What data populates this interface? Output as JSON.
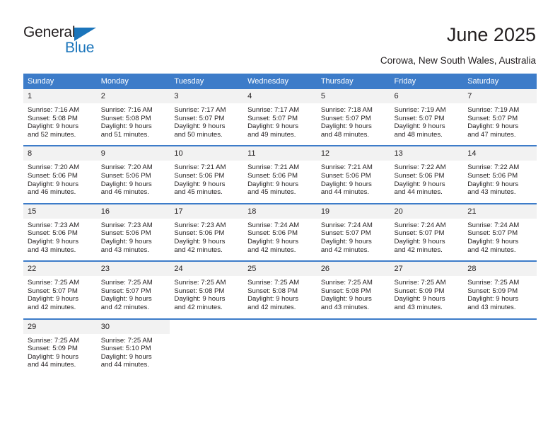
{
  "brand": {
    "name_part1": "General",
    "name_part2": "Blue",
    "accent_color": "#1b75bb"
  },
  "header": {
    "title": "June 2025",
    "subtitle": "Corowa, New South Wales, Australia"
  },
  "calendar": {
    "header_bg": "#3d7cc9",
    "daynum_bg": "#f2f2f2",
    "weekdays": [
      "Sunday",
      "Monday",
      "Tuesday",
      "Wednesday",
      "Thursday",
      "Friday",
      "Saturday"
    ],
    "weeks": [
      [
        {
          "day": "1",
          "sunrise": "Sunrise: 7:16 AM",
          "sunset": "Sunset: 5:08 PM",
          "daylight1": "Daylight: 9 hours",
          "daylight2": "and 52 minutes."
        },
        {
          "day": "2",
          "sunrise": "Sunrise: 7:16 AM",
          "sunset": "Sunset: 5:08 PM",
          "daylight1": "Daylight: 9 hours",
          "daylight2": "and 51 minutes."
        },
        {
          "day": "3",
          "sunrise": "Sunrise: 7:17 AM",
          "sunset": "Sunset: 5:07 PM",
          "daylight1": "Daylight: 9 hours",
          "daylight2": "and 50 minutes."
        },
        {
          "day": "4",
          "sunrise": "Sunrise: 7:17 AM",
          "sunset": "Sunset: 5:07 PM",
          "daylight1": "Daylight: 9 hours",
          "daylight2": "and 49 minutes."
        },
        {
          "day": "5",
          "sunrise": "Sunrise: 7:18 AM",
          "sunset": "Sunset: 5:07 PM",
          "daylight1": "Daylight: 9 hours",
          "daylight2": "and 48 minutes."
        },
        {
          "day": "6",
          "sunrise": "Sunrise: 7:19 AM",
          "sunset": "Sunset: 5:07 PM",
          "daylight1": "Daylight: 9 hours",
          "daylight2": "and 48 minutes."
        },
        {
          "day": "7",
          "sunrise": "Sunrise: 7:19 AM",
          "sunset": "Sunset: 5:07 PM",
          "daylight1": "Daylight: 9 hours",
          "daylight2": "and 47 minutes."
        }
      ],
      [
        {
          "day": "8",
          "sunrise": "Sunrise: 7:20 AM",
          "sunset": "Sunset: 5:06 PM",
          "daylight1": "Daylight: 9 hours",
          "daylight2": "and 46 minutes."
        },
        {
          "day": "9",
          "sunrise": "Sunrise: 7:20 AM",
          "sunset": "Sunset: 5:06 PM",
          "daylight1": "Daylight: 9 hours",
          "daylight2": "and 46 minutes."
        },
        {
          "day": "10",
          "sunrise": "Sunrise: 7:21 AM",
          "sunset": "Sunset: 5:06 PM",
          "daylight1": "Daylight: 9 hours",
          "daylight2": "and 45 minutes."
        },
        {
          "day": "11",
          "sunrise": "Sunrise: 7:21 AM",
          "sunset": "Sunset: 5:06 PM",
          "daylight1": "Daylight: 9 hours",
          "daylight2": "and 45 minutes."
        },
        {
          "day": "12",
          "sunrise": "Sunrise: 7:21 AM",
          "sunset": "Sunset: 5:06 PM",
          "daylight1": "Daylight: 9 hours",
          "daylight2": "and 44 minutes."
        },
        {
          "day": "13",
          "sunrise": "Sunrise: 7:22 AM",
          "sunset": "Sunset: 5:06 PM",
          "daylight1": "Daylight: 9 hours",
          "daylight2": "and 44 minutes."
        },
        {
          "day": "14",
          "sunrise": "Sunrise: 7:22 AM",
          "sunset": "Sunset: 5:06 PM",
          "daylight1": "Daylight: 9 hours",
          "daylight2": "and 43 minutes."
        }
      ],
      [
        {
          "day": "15",
          "sunrise": "Sunrise: 7:23 AM",
          "sunset": "Sunset: 5:06 PM",
          "daylight1": "Daylight: 9 hours",
          "daylight2": "and 43 minutes."
        },
        {
          "day": "16",
          "sunrise": "Sunrise: 7:23 AM",
          "sunset": "Sunset: 5:06 PM",
          "daylight1": "Daylight: 9 hours",
          "daylight2": "and 43 minutes."
        },
        {
          "day": "17",
          "sunrise": "Sunrise: 7:23 AM",
          "sunset": "Sunset: 5:06 PM",
          "daylight1": "Daylight: 9 hours",
          "daylight2": "and 42 minutes."
        },
        {
          "day": "18",
          "sunrise": "Sunrise: 7:24 AM",
          "sunset": "Sunset: 5:06 PM",
          "daylight1": "Daylight: 9 hours",
          "daylight2": "and 42 minutes."
        },
        {
          "day": "19",
          "sunrise": "Sunrise: 7:24 AM",
          "sunset": "Sunset: 5:07 PM",
          "daylight1": "Daylight: 9 hours",
          "daylight2": "and 42 minutes."
        },
        {
          "day": "20",
          "sunrise": "Sunrise: 7:24 AM",
          "sunset": "Sunset: 5:07 PM",
          "daylight1": "Daylight: 9 hours",
          "daylight2": "and 42 minutes."
        },
        {
          "day": "21",
          "sunrise": "Sunrise: 7:24 AM",
          "sunset": "Sunset: 5:07 PM",
          "daylight1": "Daylight: 9 hours",
          "daylight2": "and 42 minutes."
        }
      ],
      [
        {
          "day": "22",
          "sunrise": "Sunrise: 7:25 AM",
          "sunset": "Sunset: 5:07 PM",
          "daylight1": "Daylight: 9 hours",
          "daylight2": "and 42 minutes."
        },
        {
          "day": "23",
          "sunrise": "Sunrise: 7:25 AM",
          "sunset": "Sunset: 5:07 PM",
          "daylight1": "Daylight: 9 hours",
          "daylight2": "and 42 minutes."
        },
        {
          "day": "24",
          "sunrise": "Sunrise: 7:25 AM",
          "sunset": "Sunset: 5:08 PM",
          "daylight1": "Daylight: 9 hours",
          "daylight2": "and 42 minutes."
        },
        {
          "day": "25",
          "sunrise": "Sunrise: 7:25 AM",
          "sunset": "Sunset: 5:08 PM",
          "daylight1": "Daylight: 9 hours",
          "daylight2": "and 42 minutes."
        },
        {
          "day": "26",
          "sunrise": "Sunrise: 7:25 AM",
          "sunset": "Sunset: 5:08 PM",
          "daylight1": "Daylight: 9 hours",
          "daylight2": "and 43 minutes."
        },
        {
          "day": "27",
          "sunrise": "Sunrise: 7:25 AM",
          "sunset": "Sunset: 5:09 PM",
          "daylight1": "Daylight: 9 hours",
          "daylight2": "and 43 minutes."
        },
        {
          "day": "28",
          "sunrise": "Sunrise: 7:25 AM",
          "sunset": "Sunset: 5:09 PM",
          "daylight1": "Daylight: 9 hours",
          "daylight2": "and 43 minutes."
        }
      ],
      [
        {
          "day": "29",
          "sunrise": "Sunrise: 7:25 AM",
          "sunset": "Sunset: 5:09 PM",
          "daylight1": "Daylight: 9 hours",
          "daylight2": "and 44 minutes."
        },
        {
          "day": "30",
          "sunrise": "Sunrise: 7:25 AM",
          "sunset": "Sunset: 5:10 PM",
          "daylight1": "Daylight: 9 hours",
          "daylight2": "and 44 minutes."
        },
        {
          "day": "",
          "sunrise": "",
          "sunset": "",
          "daylight1": "",
          "daylight2": ""
        },
        {
          "day": "",
          "sunrise": "",
          "sunset": "",
          "daylight1": "",
          "daylight2": ""
        },
        {
          "day": "",
          "sunrise": "",
          "sunset": "",
          "daylight1": "",
          "daylight2": ""
        },
        {
          "day": "",
          "sunrise": "",
          "sunset": "",
          "daylight1": "",
          "daylight2": ""
        },
        {
          "day": "",
          "sunrise": "",
          "sunset": "",
          "daylight1": "",
          "daylight2": ""
        }
      ]
    ]
  }
}
